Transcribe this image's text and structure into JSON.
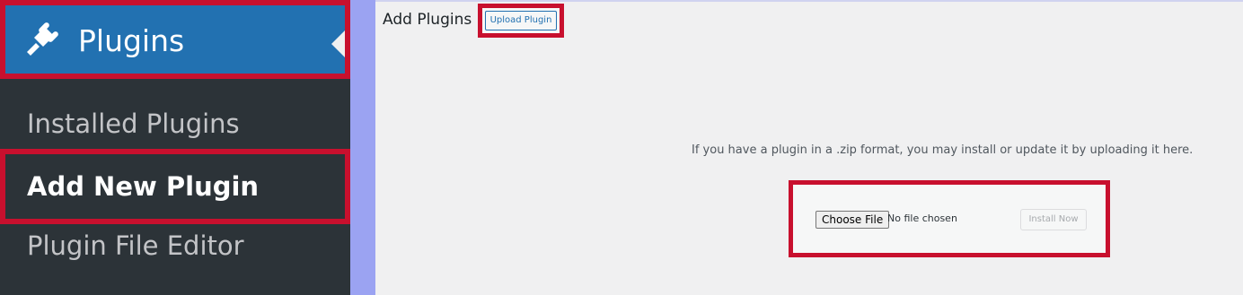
{
  "sidebar": {
    "menu_label": "Plugins",
    "menu_icon": "plug-icon",
    "items": [
      {
        "label": "Installed Plugins"
      },
      {
        "label": "Add New Plugin"
      },
      {
        "label": "Plugin File Editor"
      }
    ]
  },
  "main": {
    "title": "Add Plugins",
    "upload_plugin_label": "Upload Plugin",
    "help_text": "If you have a plugin in a .zip format, you may install or update it by uploading it here.",
    "upload_form": {
      "choose_file_label": "Choose File",
      "no_file_text": "No file chosen",
      "install_label": "Install Now"
    }
  },
  "colors": {
    "sidebar_bg": "#2c3338",
    "active_menu_bg": "#2271b1",
    "highlight_border": "#c8102e",
    "content_bg": "#f0f0f1"
  }
}
